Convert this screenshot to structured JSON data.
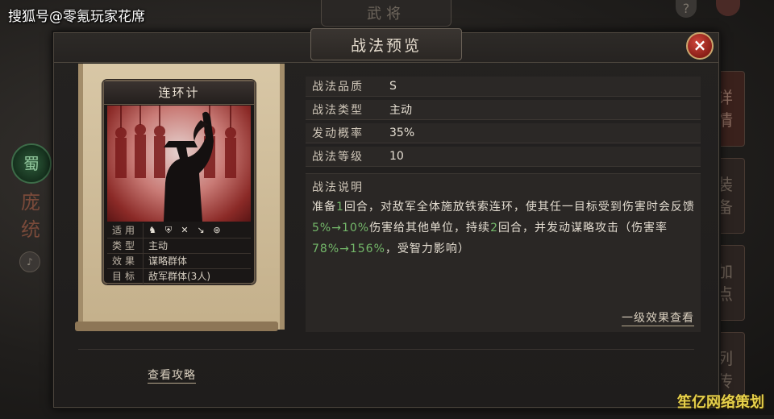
{
  "watermark": {
    "top": "搜狐号@零氪玩家花席",
    "bottom": "笙亿网络策划"
  },
  "background": {
    "tab_title": "武将",
    "help_icon": "?",
    "left_faction": "蜀",
    "left_name": "庞统",
    "right_tabs": [
      "详情",
      "装备",
      "加点",
      "列传"
    ]
  },
  "dialog": {
    "title": "战法预览",
    "close_icon": "×",
    "card": {
      "name": "连环计",
      "rows": [
        {
          "key": "适用",
          "icons": [
            "cavalry-icon",
            "shield-icon",
            "bow-icon",
            "spear-icon",
            "siege-icon"
          ]
        },
        {
          "key": "类型",
          "value": "主动"
        },
        {
          "key": "效果",
          "value": "谋略群体"
        },
        {
          "key": "目标",
          "value": "敌军群体(3人)"
        }
      ]
    },
    "attributes": [
      {
        "key": "战法品质",
        "value": "S"
      },
      {
        "key": "战法类型",
        "value": "主动"
      },
      {
        "key": "发动概率",
        "value": "35%"
      },
      {
        "key": "战法等级",
        "value": "10"
      }
    ],
    "description": {
      "title": "战法说明",
      "seg1": "准备",
      "seg2": "1",
      "seg3": "回合，对敌军全体施放铁索连环，使其任一目标受到伤害时会反馈",
      "seg4": "5%→10%",
      "seg5": "伤害给其他单位，持续",
      "seg6": "2",
      "seg7": "回合，并发动谋略攻击（伤害率",
      "seg8": "78%→156%",
      "seg9": "，受智力影响）"
    },
    "effect_link": "一级效果查看",
    "guide_link": "查看攻略"
  }
}
